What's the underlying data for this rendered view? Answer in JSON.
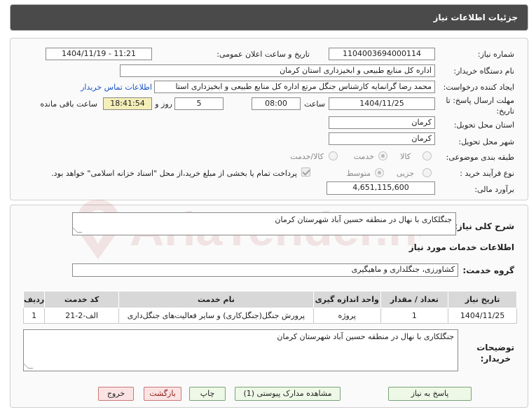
{
  "header": {
    "title": "جزئیات اطلاعات نیاز"
  },
  "form": {
    "need_number_label": "شماره نیاز:",
    "need_number": "1104003694000114",
    "announce_label": "تاریخ و ساعت اعلان عمومی:",
    "announce_value": "1404/11/19 - 11:21",
    "buyer_org_label": "نام دستگاه خریدار:",
    "buyer_org": "اداره کل منابع طبیعی و ابخیزداری استان کرمان",
    "creator_label": "ایجاد کننده درخواست:",
    "creator": "محمد رضا گرانمایه کارشناس جنگل مرتع اداره کل منابع طبیعی و ابخیزداری استا",
    "contact_link": "اطلاعات تماس خریدار",
    "deadline_label_1": "مهلت ارسال پاسخ: تا",
    "deadline_label_2": "تاریخ:",
    "deadline_date": "1404/11/25",
    "time_label": "ساعت",
    "deadline_time": "08:00",
    "days_value": "5",
    "days_label": "روز و",
    "remaining_time": "18:41:54",
    "remaining_label": "ساعت باقی مانده",
    "province_label": "استان محل تحویل:",
    "province": "کرمان",
    "city_label": "شهر محل تحویل:",
    "city": "کرمان",
    "category_label": "طبقه بندی موضوعی:",
    "category_options": [
      "کالا",
      "خدمت",
      "کالا/خدمت"
    ],
    "category_selected": "خدمت",
    "process_label": "نوع فرآیند خرید :",
    "process_options": [
      "جزیی",
      "متوسط"
    ],
    "process_selected": "متوسط",
    "payment_note": "پرداخت تمام یا بخشی از مبلغ خرید،از محل \"اسناد خزانه اسلامی\" خواهد بود.",
    "estimate_label": "برآورد مالی:",
    "estimate": "4,651,115,600"
  },
  "description": {
    "label": "شرح کلی نیاز:",
    "text": "جنگلکاری با نهال در منطقه حسین آباد شهرستان کرمان"
  },
  "services": {
    "section_title": "اطلاعات خدمات مورد نیاز",
    "group_label": "گروه خدمت:",
    "group_value": "کشاورزی، جنگلداری و ماهیگیری",
    "table": {
      "headers": [
        "ردیف",
        "کد خدمت",
        "نام خدمت",
        "واحد اندازه گیری",
        "تعداد / مقدار",
        "تاریخ نیاز"
      ],
      "rows": [
        [
          "1",
          "الف-2-21",
          "پرورش جنگل(جنگل‌کاری) و سایر فعالیت‌های جنگل‌داری",
          "پروژه",
          "1",
          "1404/11/25"
        ]
      ]
    }
  },
  "buyer_notes": {
    "label_1": "توضیحات",
    "label_2": "خریدار:",
    "text": "جنگلکاری با نهال در منطقه حسین آباد شهرستان کرمان"
  },
  "buttons": {
    "reply": "پاسخ به نیاز",
    "attachments": "مشاهده مدارک پیوستی (1)",
    "print": "چاپ",
    "back": "بازگشت",
    "exit": "خروج"
  },
  "watermark_text": "AriaTender.net",
  "colors": {
    "header_bg": "#4a4a4a",
    "link": "#1a56c8",
    "remaining_bg": "#f4efb8",
    "reply_btn_bg": "#eef8e6",
    "exit_btn_bg": "#fbe3e3"
  }
}
